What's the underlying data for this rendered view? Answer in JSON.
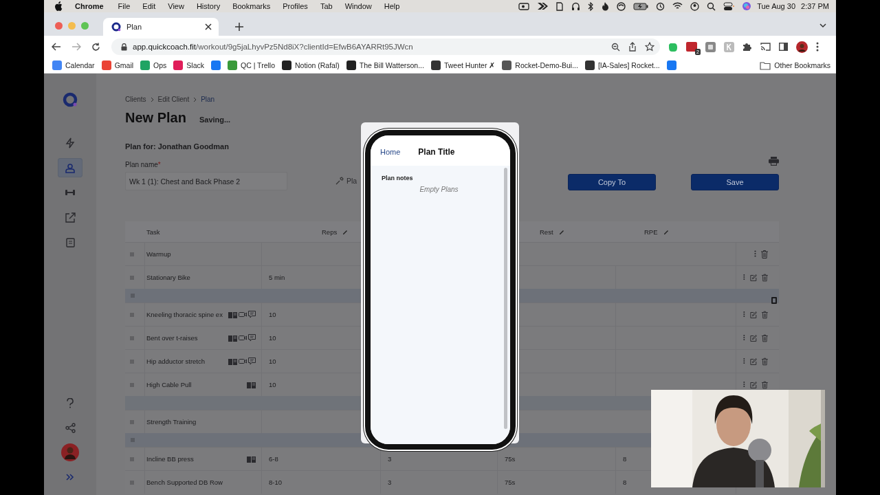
{
  "menu_bar": {
    "app": "Chrome",
    "items": [
      "File",
      "Edit",
      "View",
      "History",
      "Bookmarks",
      "Profiles",
      "Tab",
      "Window",
      "Help"
    ],
    "date": "Tue Aug 30",
    "time": "2:37 PM"
  },
  "browser": {
    "tab": {
      "title": "Plan"
    },
    "url": {
      "host": "app.quickcoach.fit",
      "path": "/workout/9g5jaLhyvPz5Nd8iX?clientId=EfwB6AYARRt95JWcn"
    },
    "extension_badge": "2",
    "bookmarks": [
      {
        "label": "Calendar",
        "color": "#4285f4"
      },
      {
        "label": "Gmail",
        "color": "#ea4335"
      },
      {
        "label": "Ops",
        "color": "#1fa463"
      },
      {
        "label": "Slack",
        "color": "#e01e5a"
      },
      {
        "color": "#1877f2"
      },
      {
        "label": "QC | Trello",
        "color": "#3a9a3a"
      },
      {
        "label": "Notion (Rafal)",
        "color": "#222222"
      },
      {
        "label": "The Bill Watterson...",
        "color": "#222222"
      },
      {
        "label": "Tweet Hunter ✗",
        "color": "#333333"
      },
      {
        "label": "Rocket-Demo-Bui...",
        "color": "#555555"
      },
      {
        "label": "[IA-Sales] Rocket...",
        "color": "#333333"
      },
      {
        "color": "#1877f2"
      }
    ],
    "other_bookmarks": "Other Bookmarks"
  },
  "sidebar": {
    "top": [
      {
        "kind": "bolt",
        "selected": false
      },
      {
        "kind": "user",
        "selected": true
      },
      {
        "kind": "dumbbell",
        "selected": false
      },
      {
        "kind": "external",
        "selected": false
      },
      {
        "kind": "clipboard",
        "selected": false
      }
    ],
    "bottom": [
      {
        "kind": "help",
        "selected": false
      },
      {
        "kind": "share",
        "selected": false
      },
      {
        "kind": "avatar",
        "selected": false
      },
      {
        "kind": "expand",
        "selected": false
      }
    ]
  },
  "breadcrumb": [
    "Clients",
    "Edit Client",
    "Plan"
  ],
  "title": "New Plan",
  "status": "Saving...",
  "plan_for": "Plan for: Jonathan Goodman",
  "plan_name": {
    "label": "Plan name",
    "required_mark": "*",
    "value": "Wk 1 (1): Chest and Back Phase 2"
  },
  "plan_link": "Pla",
  "buttons": [
    "Copy To",
    "Save"
  ],
  "table": {
    "columns": [
      {
        "label": "Task",
        "editable": false
      },
      {
        "label": "Reps",
        "editable": true
      },
      {
        "label": "Rest",
        "editable": true
      },
      {
        "label": "RPE",
        "editable": true
      }
    ],
    "rows": [
      {
        "kind": "section",
        "task": "Warmup"
      },
      {
        "kind": "exercise",
        "task": "Stationary Bike",
        "reps": "5 min"
      },
      {
        "kind": "group",
        "deletable": true
      },
      {
        "kind": "exercise",
        "task": "Kneeling thoracic spine ex",
        "attachments": [
          {
            "kind": "notes"
          },
          {
            "kind": "video"
          },
          {
            "kind": "comment"
          }
        ],
        "reps": "10"
      },
      {
        "kind": "exercise",
        "task": "Bent over t-raises",
        "attachments": [
          {
            "kind": "notes"
          },
          {
            "kind": "video"
          },
          {
            "kind": "comment"
          }
        ],
        "reps": "10"
      },
      {
        "kind": "exercise",
        "task": "Hip adductor stretch",
        "attachments": [
          {
            "kind": "notes"
          },
          {
            "kind": "video"
          },
          {
            "kind": "comment"
          }
        ],
        "reps": "10"
      },
      {
        "kind": "exercise",
        "task": "High Cable Pull",
        "attachments": [
          {
            "kind": "notes"
          }
        ],
        "reps": "10"
      },
      {
        "kind": "gap"
      },
      {
        "kind": "section",
        "task": "Strength Training",
        "actions_shown": false
      },
      {
        "kind": "group",
        "deletable": false
      },
      {
        "kind": "exercise",
        "task": "Incline BB press",
        "attachments": [
          {
            "kind": "notes"
          }
        ],
        "reps": "6-8",
        "sets": "3",
        "rest": "75s",
        "rpe": "8",
        "actions_shown": false
      },
      {
        "kind": "exercise",
        "task": "Bench Supported DB Row",
        "reps": "8-10",
        "sets": "3",
        "rest": "75s",
        "rpe": "8",
        "actions_shown": false
      }
    ]
  },
  "preview": {
    "back": "Home",
    "title": "Plan Title",
    "notes_label": "Plan notes",
    "empty": "Empty Plans"
  },
  "webcam": {
    "kind": "picture"
  }
}
